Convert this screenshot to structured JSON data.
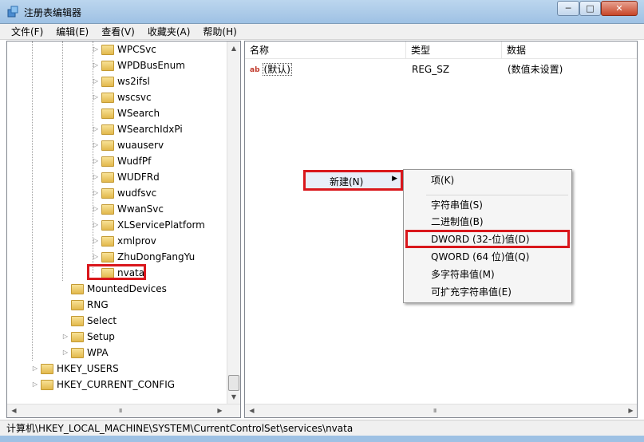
{
  "window": {
    "title": "注册表编辑器",
    "minimize_label": "─",
    "maximize_label": "□",
    "close_label": "✕"
  },
  "menubar": {
    "items": [
      "文件(F)",
      "编辑(E)",
      "查看(V)",
      "收藏夹(A)",
      "帮助(H)"
    ]
  },
  "tree": {
    "items": [
      {
        "label": "WPCSvc",
        "expandable": true
      },
      {
        "label": "WPDBusEnum",
        "expandable": true
      },
      {
        "label": "ws2ifsl",
        "expandable": true
      },
      {
        "label": "wscsvc",
        "expandable": true
      },
      {
        "label": "WSearch",
        "expandable": false
      },
      {
        "label": "WSearchIdxPi",
        "expandable": true
      },
      {
        "label": "wuauserv",
        "expandable": true
      },
      {
        "label": "WudfPf",
        "expandable": true
      },
      {
        "label": "WUDFRd",
        "expandable": true
      },
      {
        "label": "wudfsvc",
        "expandable": true
      },
      {
        "label": "WwanSvc",
        "expandable": true
      },
      {
        "label": "XLServicePlatform",
        "expandable": true
      },
      {
        "label": "xmlprov",
        "expandable": true
      },
      {
        "label": "ZhuDongFangYu",
        "expandable": true
      },
      {
        "label": "nvata",
        "expandable": false,
        "selected": true
      },
      {
        "label": "MountedDevices",
        "expandable": false
      },
      {
        "label": "RNG",
        "expandable": false
      },
      {
        "label": "Select",
        "expandable": false
      },
      {
        "label": "Setup",
        "expandable": true
      },
      {
        "label": "WPA",
        "expandable": true
      },
      {
        "label": "HKEY_USERS",
        "expandable": true
      },
      {
        "label": "HKEY_CURRENT_CONFIG",
        "expandable": true
      }
    ]
  },
  "list": {
    "columns": [
      "名称",
      "类型",
      "数据"
    ],
    "rows": [
      {
        "icon": "ab",
        "name": "(默认)",
        "type": "REG_SZ",
        "data": "(数值未设置)"
      }
    ]
  },
  "context_menu": {
    "new_label": "新建(N)",
    "submenu": [
      "项(K)",
      "字符串值(S)",
      "二进制值(B)",
      "DWORD (32-位)值(D)",
      "QWORD (64 位)值(Q)",
      "多字符串值(M)",
      "可扩充字符串值(E)"
    ]
  },
  "statusbar": {
    "path": "计算机\\HKEY_LOCAL_MACHINE\\SYSTEM\\CurrentControlSet\\services\\nvata"
  },
  "colors": {
    "highlight_box": "#d9171c",
    "titlebar": "#9ec1e4"
  }
}
